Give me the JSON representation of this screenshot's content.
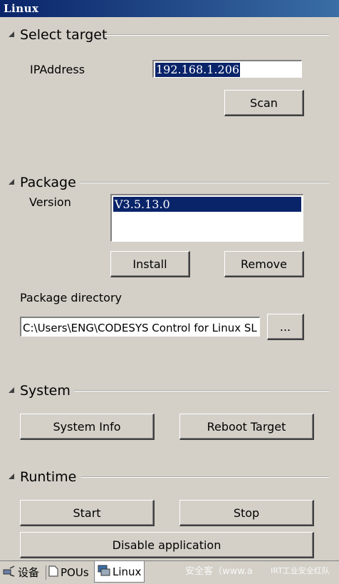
{
  "window": {
    "title": "Linux"
  },
  "select_target": {
    "heading": "Select target",
    "ip_label": "IPAddress",
    "ip_value": "192.168.1.206",
    "scan_label": "Scan"
  },
  "package": {
    "heading": "Package",
    "version_label": "Version",
    "versions": [
      "V3.5.13.0"
    ],
    "install_label": "Install",
    "remove_label": "Remove",
    "dir_label": "Package directory",
    "dir_value": "C:\\Users\\ENG\\CODESYS Control for Linux SL",
    "browse_label": "..."
  },
  "system": {
    "heading": "System",
    "info_label": "System Info",
    "reboot_label": "Reboot Target"
  },
  "runtime": {
    "heading": "Runtime",
    "start_label": "Start",
    "stop_label": "Stop",
    "disable_label": "Disable application"
  },
  "tabs": [
    {
      "label": "设备",
      "icon": "devices-icon"
    },
    {
      "label": "POUs",
      "icon": "pou-icon"
    },
    {
      "label": "Linux",
      "icon": "linux-tab-icon"
    }
  ],
  "watermark": {
    "left": "安全客（www.a",
    "right": "IRT工业安全红队"
  }
}
